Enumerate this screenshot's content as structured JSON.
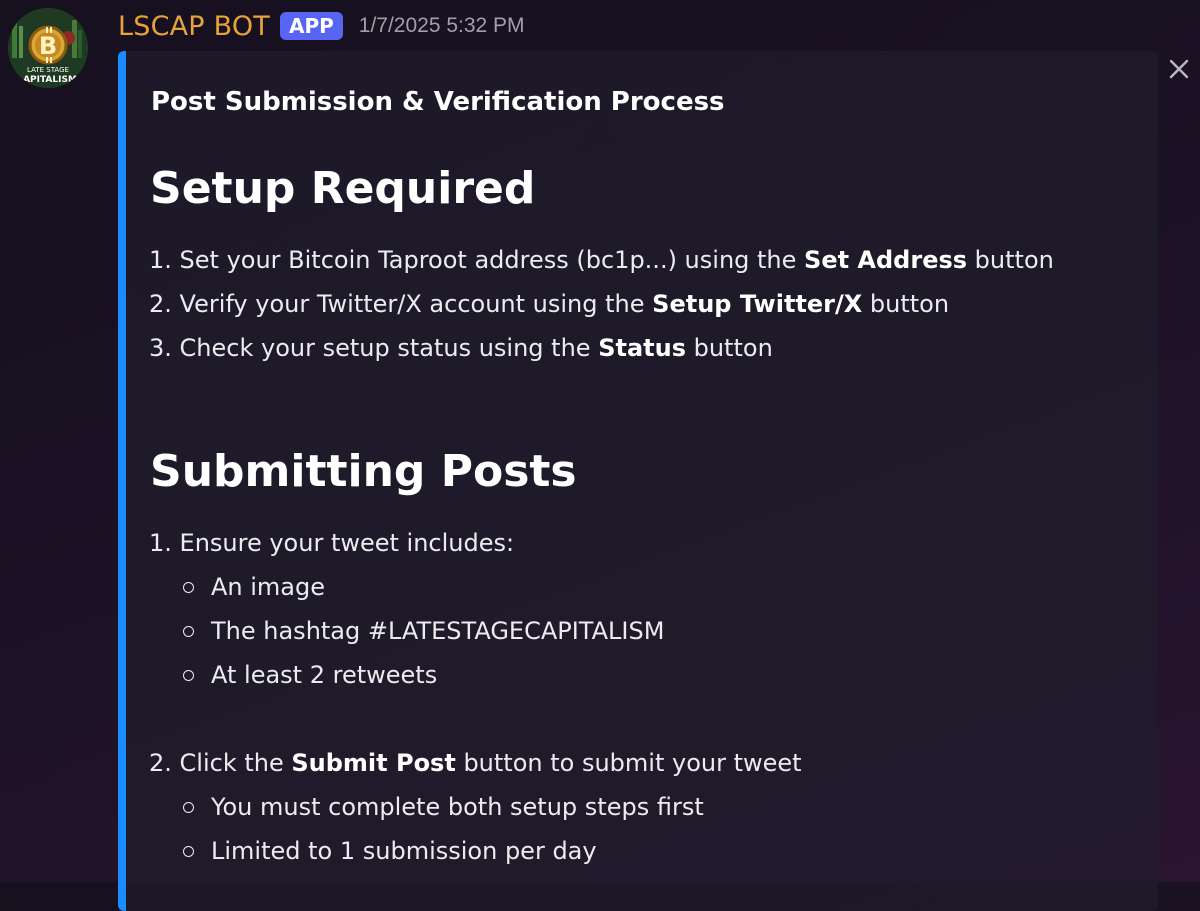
{
  "message": {
    "author": "LSCAP BOT",
    "badge": "APP",
    "timestamp": "1/7/2025 5:32 PM",
    "avatar_text": [
      "LATE STAGE",
      "APITALISM"
    ]
  },
  "embed": {
    "accent_color": "#1a8cff",
    "title": "Post Submission & Verification Process",
    "setup": {
      "heading": "Setup Required",
      "items": [
        {
          "prefix": "1. Set your Bitcoin Taproot address (bc1p...) using the ",
          "bold": "Set Address",
          "suffix": " button"
        },
        {
          "prefix": "2. Verify your Twitter/X account using the ",
          "bold": "Setup Twitter/X",
          "suffix": " button"
        },
        {
          "prefix": "3. Check your setup status using the ",
          "bold": "Status",
          "suffix": " button"
        }
      ]
    },
    "submitting": {
      "heading": "Submitting Posts",
      "step1": {
        "text": "1. Ensure your tweet includes:",
        "bullets": [
          "An image",
          "The hashtag #LATESTAGECAPITALISM",
          "At least 2 retweets"
        ]
      },
      "step2": {
        "prefix": "2. Click the ",
        "bold": "Submit Post",
        "suffix": " button to submit your tweet",
        "bullets": [
          "You must complete both setup steps first",
          "Limited to 1 submission per day"
        ]
      }
    }
  },
  "icons": {
    "close": "close-icon",
    "avatar": "bitcoin-logo-icon"
  }
}
